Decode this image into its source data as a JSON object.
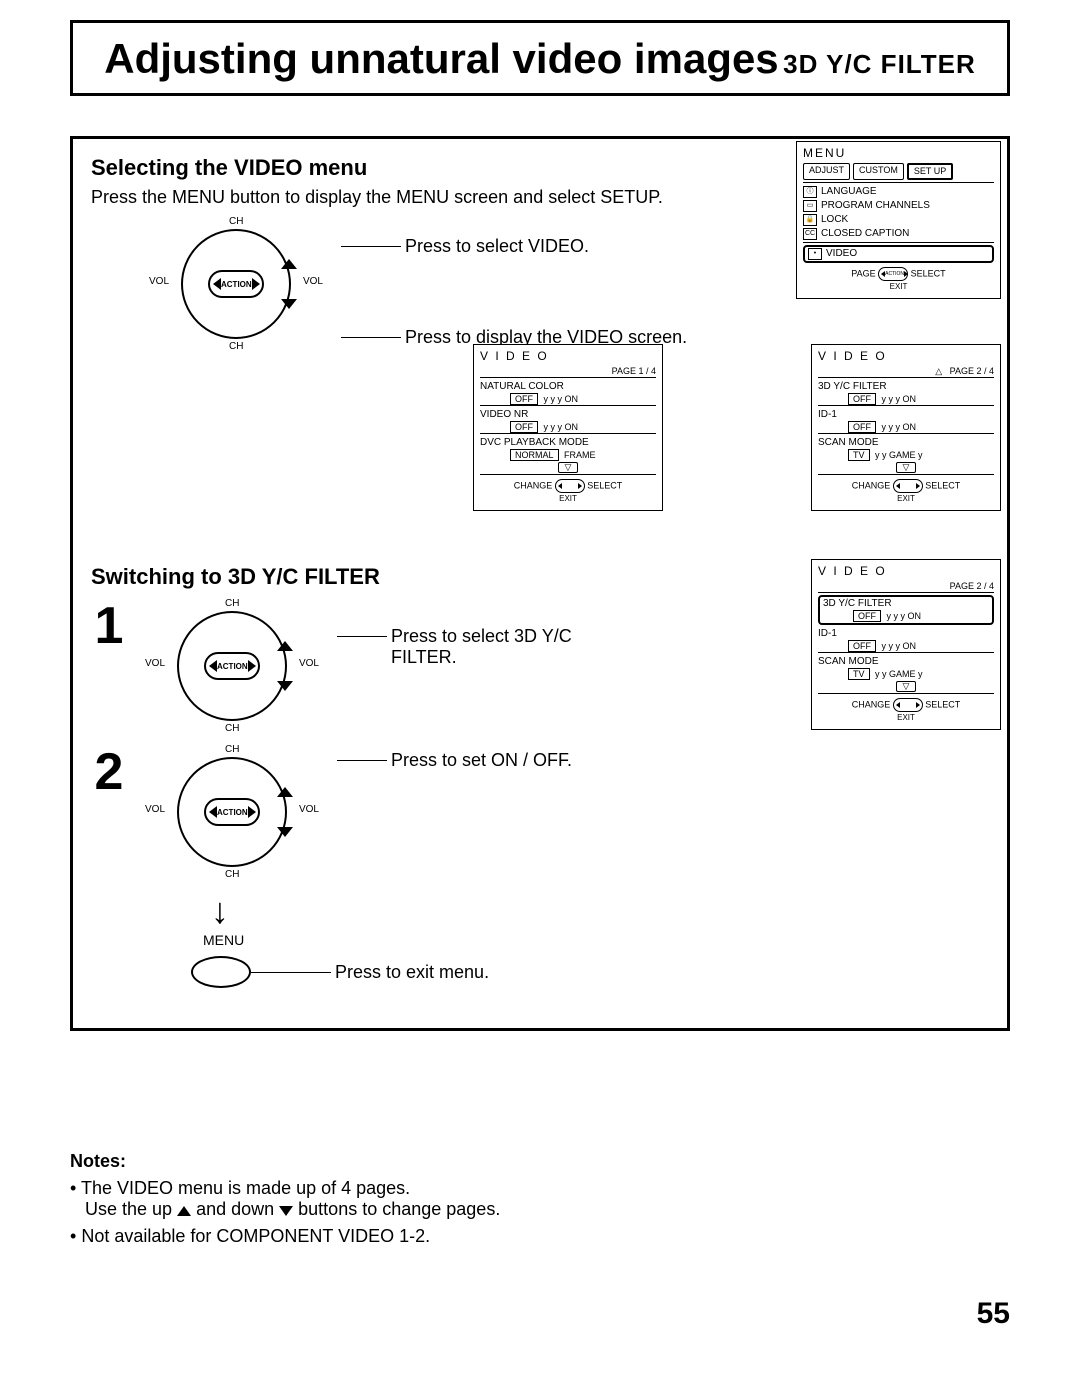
{
  "page_number": "55",
  "title": {
    "main": "Adjusting unnatural video images",
    "sub": "3D Y/C FILTER"
  },
  "section1": {
    "heading": "Selecting the VIDEO menu",
    "intro": "Press the MENU button to display the MENU screen and select SETUP.",
    "instr_select": "Press to select VIDEO.",
    "instr_display": "Press to display the VIDEO screen."
  },
  "nav_labels": {
    "ch": "CH",
    "vol": "VOL",
    "action": "ACTION"
  },
  "section2": {
    "heading": "Switching to 3D Y/C FILTER",
    "step1_num": "1",
    "step1_instr": "Press to select 3D Y/C FILTER.",
    "step2_num": "2",
    "step2_instr": "Press to set ON / OFF.",
    "menu_btn_label": "MENU",
    "exit_instr": "Press to exit menu."
  },
  "osd_menu": {
    "title": "MENU",
    "tabs": [
      "ADJUST",
      "CUSTOM",
      "SET UP"
    ],
    "items": {
      "language": "LANGUAGE",
      "program": "PROGRAM  CHANNELS",
      "lock": "LOCK",
      "cc": "CLOSED  CAPTION",
      "video": "VIDEO"
    },
    "foot_page": "PAGE",
    "foot_action": "ACTION",
    "foot_select": "SELECT",
    "foot_exit": "EXIT"
  },
  "osd_video1": {
    "title": "V I D E O",
    "page": "PAGE 1 / 4",
    "natural_color": "NATURAL  COLOR",
    "nc_off": "OFF",
    "nc_on": "ON",
    "video_nr": "VIDEO  NR",
    "vnr_off": "OFF",
    "vnr_on": "ON",
    "dvc": "DVC  PLAYBACK  MODE",
    "dvc_normal": "NORMAL",
    "dvc_frame": "FRAME",
    "foot_change": "CHANGE",
    "foot_select": "SELECT",
    "foot_exit": "EXIT"
  },
  "osd_video2": {
    "title": "V I D E O",
    "page": "PAGE 2 / 4",
    "yc": "3D Y/C FILTER",
    "yc_off": "OFF",
    "yc_on": "ON",
    "id1": "ID-1",
    "id1_off": "OFF",
    "id1_on": "ON",
    "scan": "SCAN  MODE",
    "scan_tv": "TV",
    "scan_game": "GAME",
    "foot_change": "CHANGE",
    "foot_select": "SELECT",
    "foot_exit": "EXIT"
  },
  "notes": {
    "heading": "Notes:",
    "n1": "The VIDEO menu is made up of 4 pages.",
    "n1b_a": "Use the up ",
    "n1b_b": " and down ",
    "n1b_c": " buttons to change pages.",
    "n2": "Not available for COMPONENT VIDEO 1-2.",
    "bullet": "•"
  },
  "marker_text": "y y y"
}
